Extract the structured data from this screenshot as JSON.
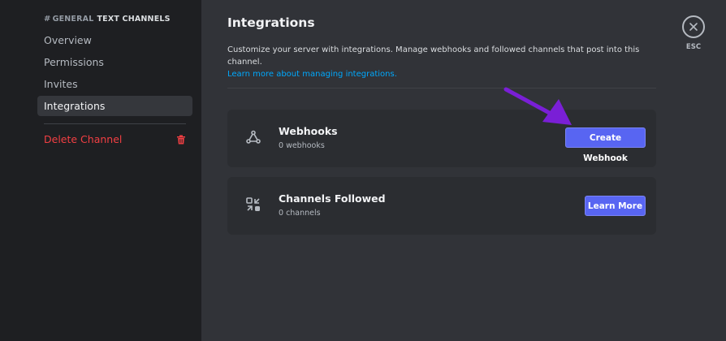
{
  "sidebar": {
    "header_hash": "#",
    "header_category": "GENERAL",
    "header_name": "TEXT CHANNELS",
    "items": [
      {
        "label": "Overview"
      },
      {
        "label": "Permissions"
      },
      {
        "label": "Invites"
      },
      {
        "label": "Integrations"
      }
    ],
    "delete_label": "Delete Channel"
  },
  "main": {
    "title": "Integrations",
    "description": "Customize your server with integrations. Manage webhooks and followed channels that post into this channel.",
    "learn_link": "Learn more about managing integrations.",
    "cards": [
      {
        "title": "Webhooks",
        "sub": "0 webhooks",
        "button": "Create Webhook",
        "icon": "webhook-icon"
      },
      {
        "title": "Channels Followed",
        "sub": "0 channels",
        "button": "Learn More",
        "icon": "channels-followed-icon"
      }
    ]
  },
  "close": {
    "label": "ESC"
  },
  "colors": {
    "accent": "#5865f2",
    "danger": "#f23f43",
    "link": "#00a8fc",
    "annotation_arrow": "#7a1fd6"
  }
}
